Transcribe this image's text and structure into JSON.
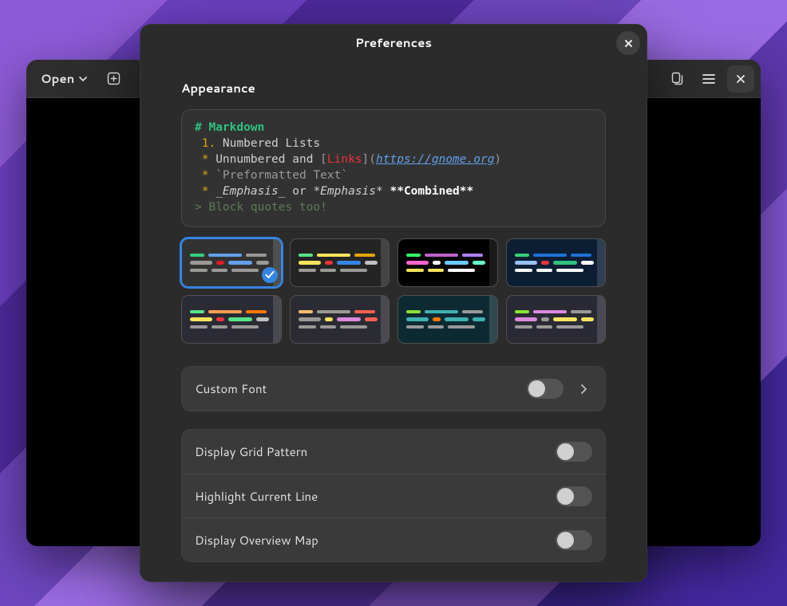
{
  "editor": {
    "open_label": "Open"
  },
  "dialog": {
    "title": "Preferences",
    "section": "Appearance"
  },
  "preview": {
    "h1_hash": "# ",
    "h1_text": "Markdown",
    "l2_num": " 1. ",
    "l2_rest": "Numbered Lists",
    "l3_star": " * ",
    "l3_a": "Unnumbered and ",
    "l3_br1": "[",
    "l3_link": "Links",
    "l3_br2": "](",
    "l3_url": "https://gnome.org",
    "l3_br3": ")",
    "l4_star": " * ",
    "l4_code": "`Preformatted Text`",
    "l5_star": " * ",
    "l5_em1": "_Emphasis_",
    "l5_mid": " or ",
    "l5_em2": "*Emphasis*",
    "l5_sp": " ",
    "l5_bold": "**Combined**",
    "l6": "> Block quotes too!"
  },
  "themes": {
    "selected": 0
  },
  "rows": {
    "custom_font": {
      "label": "Custom Font",
      "on": false
    },
    "grid": {
      "label": "Display Grid Pattern",
      "on": false
    },
    "hl_line": {
      "label": "Highlight Current Line",
      "on": false
    },
    "overview": {
      "label": "Display Overview Map",
      "on": false
    }
  }
}
